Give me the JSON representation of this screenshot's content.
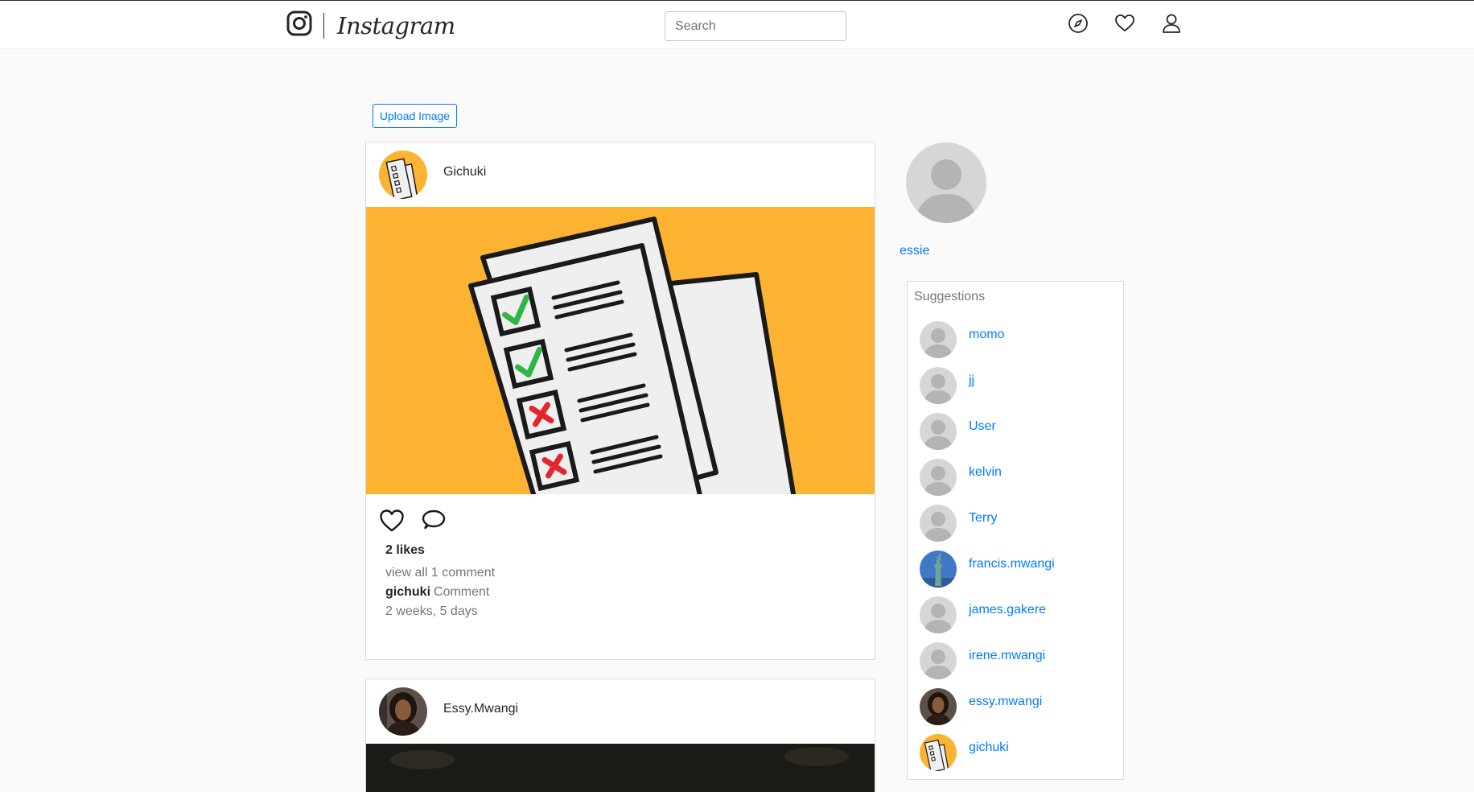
{
  "navbar": {
    "brand_name": "Instagram",
    "search_placeholder": "Search",
    "icons": [
      "instagram-logo-icon",
      "compass-icon",
      "heart-icon",
      "user-icon"
    ]
  },
  "upload": {
    "label": "Upload Image"
  },
  "posts": [
    {
      "username": "Gichuki",
      "likes": "2 likes",
      "view_comments": "view all 1 comment",
      "comment_user": "gichuki",
      "comment_text": "Comment",
      "timestamp": "2 weeks, 5 days"
    },
    {
      "username": "Essy.Mwangi"
    }
  ],
  "profile": {
    "username": "essie"
  },
  "suggestions": {
    "title": "Suggestions",
    "users": [
      {
        "name": "momo",
        "avatar": "default"
      },
      {
        "name": "jj",
        "avatar": "default"
      },
      {
        "name": "User",
        "avatar": "default"
      },
      {
        "name": "kelvin",
        "avatar": "default"
      },
      {
        "name": "Terry",
        "avatar": "default"
      },
      {
        "name": "francis.mwangi",
        "avatar": "statue-of-liberty"
      },
      {
        "name": "james.gakere",
        "avatar": "default"
      },
      {
        "name": "irene.mwangi",
        "avatar": "default"
      },
      {
        "name": "essy.mwangi",
        "avatar": "woman-portrait"
      },
      {
        "name": "gichuki",
        "avatar": "checklist"
      }
    ]
  },
  "colors": {
    "link_blue": "#007bff",
    "post_image_bg": "#fbb331",
    "check_green": "#2fb544",
    "cross_red": "#e3262b"
  }
}
